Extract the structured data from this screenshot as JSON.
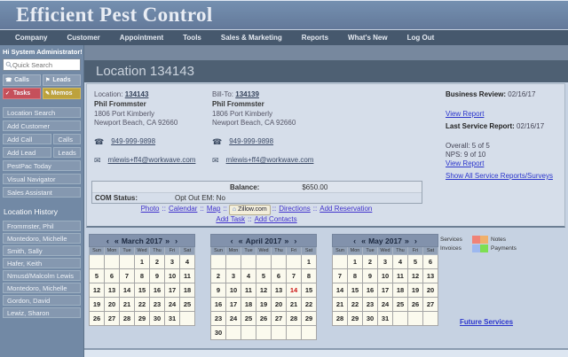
{
  "app": {
    "title": "Efficient Pest Control"
  },
  "menu": {
    "items": [
      "Company",
      "Customer",
      "Appointment",
      "Tools",
      "Sales & Marketing",
      "Reports",
      "What's New",
      "Log Out"
    ]
  },
  "sidebar": {
    "greeting": "Hi System Administrator!",
    "search_placeholder": "Quick Search",
    "quick_buttons": [
      {
        "label": "Calls",
        "icon": "phone-icon",
        "variant": ""
      },
      {
        "label": "Leads",
        "icon": "flag-icon",
        "variant": ""
      },
      {
        "label": "Tasks",
        "icon": "check-icon",
        "variant": "red"
      },
      {
        "label": "Memos",
        "icon": "memo-icon",
        "variant": "gold"
      }
    ],
    "nav_rows": [
      [
        "Location Search"
      ],
      [
        "Add Customer"
      ],
      [
        "Add Call",
        "Calls"
      ],
      [
        "Add Lead",
        "Leads"
      ],
      [
        "PestPac Today"
      ],
      [
        "Visual Navigator"
      ],
      [
        "Sales Assistant"
      ]
    ],
    "history_title": "Location History",
    "history_items": [
      "Frommster, Phil",
      "Montedoro, Michelle",
      "Smith, Sally",
      "Hafer, Keith",
      "Nmusd/Malcolm Lewis",
      "Montedoro, Michelle",
      "Gordon, David",
      "Lewiz, Sharon"
    ]
  },
  "page": {
    "title": "Location 134143"
  },
  "location": {
    "label": "Location:",
    "id": "134143",
    "name": "Phil Frommster",
    "address1": "1806 Port Kimberly",
    "address2": "Newport Beach, CA 92660",
    "phone": "949-999-9898",
    "email": "mlewis+ff4@workwave.com"
  },
  "billto": {
    "label": "Bill-To:",
    "id": "134139",
    "name": "Phil Frommster",
    "address1": "1806 Port Kimberly",
    "address2": "Newport Beach, CA 92660",
    "phone": "949-999-9898",
    "email": "mlewis+ff4@workwave.com"
  },
  "reports": {
    "business_review_label": "Business Review:",
    "business_review_date": "02/16/17",
    "view_report": "View Report",
    "last_service_label": "Last Service Report:",
    "last_service_date": "02/16/17",
    "overall": "Overall: 5 of 5",
    "nps": "NPS: 9 of 10",
    "view_report2": "View Report",
    "show_all": "Show All Service Reports/Surveys"
  },
  "balance": {
    "label": "Balance:",
    "value": "$650.00",
    "com_label": "COM Status:",
    "com_value": "Opt Out EM: No"
  },
  "quicklinks": {
    "separator": "::",
    "row1": [
      {
        "type": "link",
        "label": "Photo"
      },
      {
        "type": "link",
        "label": "Calendar"
      },
      {
        "type": "link",
        "label": "Map"
      },
      {
        "type": "zillow",
        "label": "Zillow.com"
      },
      {
        "type": "link",
        "label": "Directions"
      },
      {
        "type": "link",
        "label": "Add Reservation"
      }
    ],
    "row2": [
      {
        "type": "link",
        "label": "Add Task"
      },
      {
        "type": "link",
        "label": "Add Contacts"
      }
    ]
  },
  "calendars": {
    "arrows": [
      "‹",
      "«",
      "»",
      "›"
    ],
    "day_names": [
      "Sun",
      "Mon",
      "Tue",
      "Wed",
      "Thu",
      "Fri",
      "Sat"
    ],
    "months": [
      {
        "title": "March 2017",
        "today": "",
        "weeks": [
          [
            "",
            "",
            "",
            "1",
            "2",
            "3",
            "4"
          ],
          [
            "5",
            "6",
            "7",
            "8",
            "9",
            "10",
            "11"
          ],
          [
            "12",
            "13",
            "14",
            "15",
            "16",
            "17",
            "18"
          ],
          [
            "19",
            "20",
            "21",
            "22",
            "23",
            "24",
            "25"
          ],
          [
            "26",
            "27",
            "28",
            "29",
            "30",
            "31",
            ""
          ]
        ]
      },
      {
        "title": "April 2017",
        "today": "14",
        "weeks": [
          [
            "",
            "",
            "",
            "",
            "",
            "",
            "1"
          ],
          [
            "2",
            "3",
            "4",
            "5",
            "6",
            "7",
            "8"
          ],
          [
            "9",
            "10",
            "11",
            "12",
            "13",
            "14",
            "15"
          ],
          [
            "16",
            "17",
            "18",
            "19",
            "20",
            "21",
            "22"
          ],
          [
            "23",
            "24",
            "25",
            "26",
            "27",
            "28",
            "29"
          ],
          [
            "30",
            "",
            "",
            "",
            "",
            "",
            ""
          ]
        ]
      },
      {
        "title": "May 2017",
        "today": "",
        "weeks": [
          [
            "",
            "1",
            "2",
            "3",
            "4",
            "5",
            "6"
          ],
          [
            "7",
            "8",
            "9",
            "10",
            "11",
            "12",
            "13"
          ],
          [
            "14",
            "15",
            "16",
            "17",
            "18",
            "19",
            "20"
          ],
          [
            "21",
            "22",
            "23",
            "24",
            "25",
            "26",
            "27"
          ],
          [
            "28",
            "29",
            "30",
            "31",
            "",
            "",
            ""
          ]
        ]
      }
    ]
  },
  "legend": {
    "rows": [
      {
        "left": "Services",
        "left_color": "#ef8377",
        "right": "Notes",
        "right_color": "#f0b06a"
      },
      {
        "left": "Invoices",
        "left_color": "#9db8ef",
        "right": "Payments",
        "right_color": "#7ddf52"
      }
    ]
  },
  "future_services": "Future Services"
}
